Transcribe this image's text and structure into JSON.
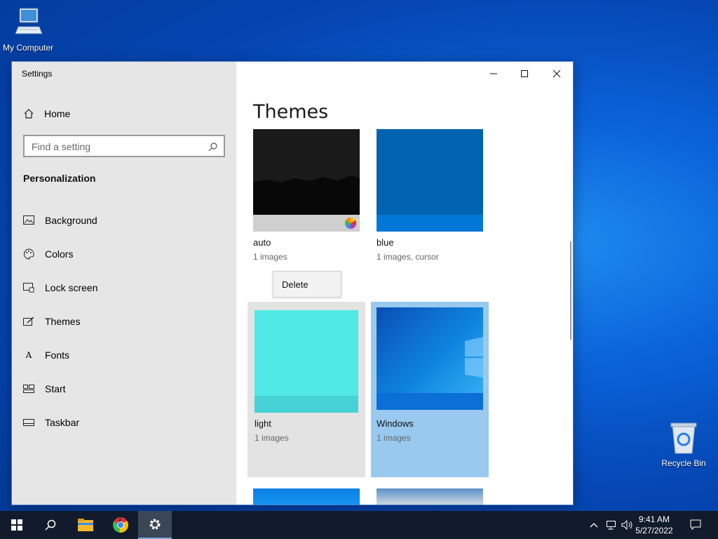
{
  "desktop": {
    "icons": [
      {
        "label": "My Computer",
        "icon": "computer-icon"
      },
      {
        "label": "Recycle Bin",
        "icon": "recycle-bin-icon"
      }
    ]
  },
  "window": {
    "title": "Settings",
    "controls": {
      "minimize": "minimize-icon",
      "maximize": "maximize-icon",
      "close": "close-icon"
    }
  },
  "sidebar": {
    "home": "Home",
    "search_placeholder": "Find a setting",
    "section": "Personalization",
    "items": [
      {
        "label": "Background",
        "icon": "background-icon"
      },
      {
        "label": "Colors",
        "icon": "palette-icon"
      },
      {
        "label": "Lock screen",
        "icon": "lock-screen-icon"
      },
      {
        "label": "Themes",
        "icon": "themes-icon"
      },
      {
        "label": "Fonts",
        "icon": "fonts-icon"
      },
      {
        "label": "Start",
        "icon": "start-icon"
      },
      {
        "label": "Taskbar",
        "icon": "taskbar-icon"
      }
    ]
  },
  "main": {
    "title": "Themes",
    "themes": [
      {
        "name": "auto",
        "sub": "1 images"
      },
      {
        "name": "blue",
        "sub": "1 images, cursor"
      },
      {
        "name": "light",
        "sub": "1 images"
      },
      {
        "name": "Windows",
        "sub": "1 images"
      }
    ],
    "context_menu": {
      "delete": "Delete"
    }
  },
  "taskbar": {
    "apps": [
      "start-icon",
      "search-icon",
      "file-explorer-icon",
      "chrome-icon",
      "settings-icon"
    ],
    "clock": {
      "time": "9:41 AM",
      "date": "5/27/2022"
    }
  },
  "colors": {
    "accent": "#0078d7",
    "selected_tile": "#99c9ef",
    "blue_theme": "#0063b1",
    "light_theme": "#4fe8e4"
  }
}
